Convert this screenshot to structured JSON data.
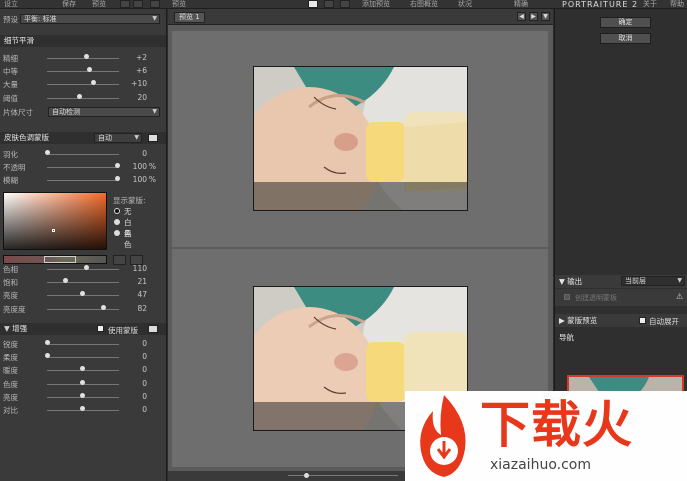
{
  "topbar": {
    "left_labels": [
      "设立",
      "保存",
      "预览"
    ],
    "center_labels": [
      "预览",
      "添加预览",
      "右图概览",
      "状况",
      "精确"
    ],
    "product_title": "PORTRAITURE 2",
    "right_labels": [
      "关于",
      "帮助"
    ]
  },
  "preset": {
    "label": "预设",
    "value": "平衡: 标准"
  },
  "detail": {
    "title": "细节平滑",
    "rows": [
      {
        "label": "精细",
        "value": "+2",
        "level": 0.55
      },
      {
        "label": "中等",
        "value": "+6",
        "level": 0.6
      },
      {
        "label": "大量",
        "value": "+10",
        "level": 0.65
      },
      {
        "label": "阈值",
        "value": "20",
        "level": 0.45
      }
    ],
    "feature_label": "片体尺寸",
    "feature_value": "自动检测"
  },
  "skin": {
    "title": "皮肤色调蒙版",
    "mode": "自动",
    "rows": [
      {
        "label": "羽化",
        "value": "0",
        "unit": "",
        "level": 0.0
      },
      {
        "label": "不透明",
        "value": "100",
        "unit": "%",
        "level": 1.0
      },
      {
        "label": "模糊",
        "value": "100",
        "unit": "%",
        "level": 1.0
      }
    ],
    "show_mask_label": "显示蒙版:",
    "mask_options": [
      "无",
      "白色",
      "黑色"
    ],
    "mask_selected": 0,
    "adjust_rows": [
      {
        "label": "色相",
        "value": "110",
        "level": 0.55
      },
      {
        "label": "饱和",
        "value": "21",
        "level": 0.25
      },
      {
        "label": "亮度",
        "value": "47",
        "level": 0.5
      },
      {
        "label": "亮度度",
        "value": "82",
        "level": 0.8
      }
    ]
  },
  "enhance": {
    "title": "增强",
    "use_mask_label": "使用蒙版",
    "rows": [
      {
        "label": "锐度",
        "value": "0",
        "level": 0.0
      },
      {
        "label": "柔度",
        "value": "0",
        "level": 0.0
      },
      {
        "label": "暖度",
        "value": "0",
        "level": 0.5
      },
      {
        "label": "色度",
        "value": "0",
        "level": 0.5
      },
      {
        "label": "亮度",
        "value": "0",
        "level": 0.5
      },
      {
        "label": "对比",
        "value": "0",
        "level": 0.5
      }
    ]
  },
  "center": {
    "tab_label": "预览 1"
  },
  "right": {
    "ok_label": "确定",
    "cancel_label": "取消",
    "output_title": "输出",
    "output_value": "当前层",
    "transparent_label": "创建透明蒙板",
    "mask_preview_title": "蒙版预览",
    "auto_expand_label": "自动展开",
    "navigator_title": "导航"
  },
  "watermark": {
    "text": "下载火",
    "url": "xiazaihuo.com"
  },
  "colors": {
    "accent_red": "#e8381c",
    "panel_bg": "#3a3a3a"
  }
}
